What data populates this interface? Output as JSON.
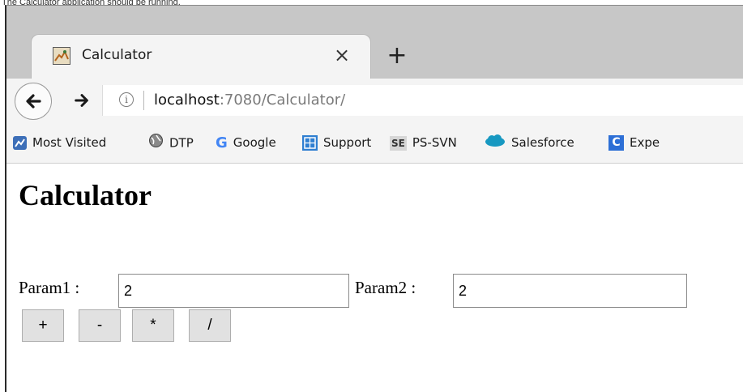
{
  "caption": "The Calculator application should be running.",
  "browser": {
    "tab": {
      "title": "Calculator",
      "close_glyph": "×",
      "favicon": "calculator-favicon"
    },
    "new_tab_glyph": "+",
    "nav": {
      "back_glyph": "🡐",
      "forward_glyph": "🡒",
      "info_glyph": "i"
    },
    "url": {
      "host": "localhost",
      "rest": ":7080/Calculator/"
    },
    "bookmarks": [
      {
        "label": "Most Visited",
        "icon": "most-visited-icon"
      },
      {
        "label": "DTP",
        "icon": "globe-icon"
      },
      {
        "label": "Google",
        "icon": "google-icon",
        "icon_glyph": "G"
      },
      {
        "label": "Support",
        "icon": "support-icon"
      },
      {
        "label": "PS-SVN",
        "icon": "se-icon",
        "icon_glyph": "SE"
      },
      {
        "label": "Salesforce",
        "icon": "salesforce-cloud-icon"
      },
      {
        "label": "Expe",
        "icon": "confluence-icon",
        "icon_glyph": "C"
      }
    ]
  },
  "page": {
    "title": "Calculator",
    "param1": {
      "label": "Param1 :",
      "value": "2"
    },
    "param2": {
      "label": "Param2 :",
      "value": "2"
    },
    "buttons": [
      {
        "label": "+"
      },
      {
        "label": "-"
      },
      {
        "label": "*"
      },
      {
        "label": "/"
      }
    ]
  },
  "colors": {
    "tab_strip": "#c7c7c7",
    "toolbar": "#f4f4f4",
    "google_blue": "#4285f4",
    "salesforce_blue": "#1798c1",
    "button_face": "#e1e1e1"
  }
}
